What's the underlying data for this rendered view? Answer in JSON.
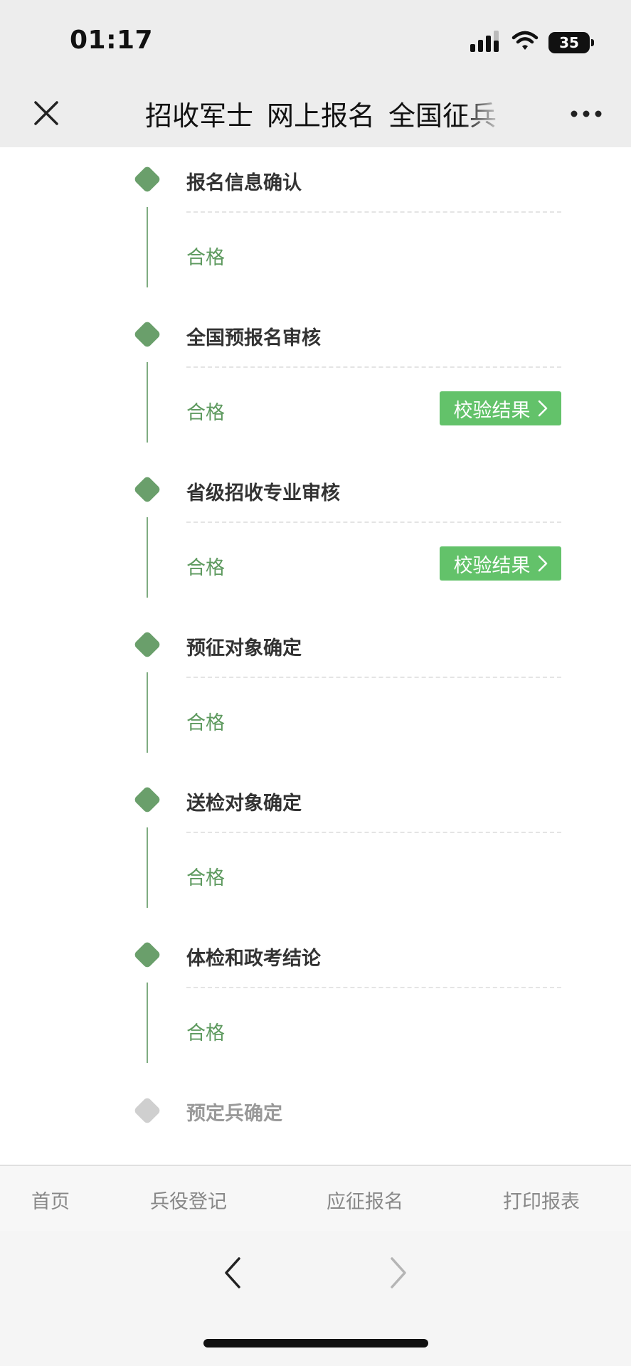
{
  "status_bar": {
    "time": "01:17",
    "battery": "35",
    "icons": [
      "signal-icon",
      "wifi-icon",
      "battery-icon"
    ]
  },
  "nav": {
    "title": "招收军士_网上报名_全国征兵",
    "close_icon": "close-icon",
    "more_icon": "more-icon"
  },
  "steps": [
    {
      "title": "报名信息确认",
      "status": "合格",
      "button": ""
    },
    {
      "title": "全国预报名审核",
      "status": "合格",
      "button": "校验结果"
    },
    {
      "title": "省级招收专业审核",
      "status": "合格",
      "button": "校验结果"
    },
    {
      "title": "预征对象确定",
      "status": "合格",
      "button": ""
    },
    {
      "title": "送检对象确定",
      "status": "合格",
      "button": ""
    },
    {
      "title": "体检和政考结论",
      "status": "合格",
      "button": ""
    },
    {
      "title": "预定兵确定",
      "status": "",
      "button": ""
    }
  ],
  "tabs": [
    "首页",
    "兵役登记",
    "应征报名",
    "打印报表"
  ],
  "colors": {
    "accent_green": "#63c26a",
    "node_green": "#6a9f6b",
    "status_green": "#5e9a5f",
    "pending_gray": "#cfcfcf"
  }
}
